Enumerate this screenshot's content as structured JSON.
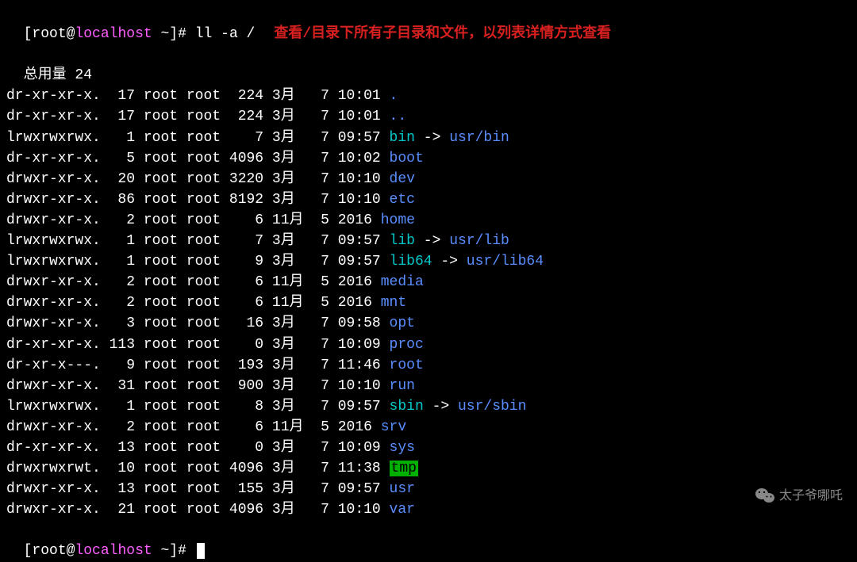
{
  "prompt": {
    "user": "root",
    "at": "@",
    "host": "localhost",
    "path": "~",
    "hash": "#",
    "command": "ll -a /"
  },
  "annotation": "查看/目录下所有子目录和文件，以列表详情方式查看",
  "total_label": "总用量",
  "total_value": "24",
  "files": [
    {
      "perms": "dr-xr-xr-x.",
      "links": "17",
      "owner": "root",
      "group": "root",
      "size": "224",
      "month": "3月 ",
      "day": "7",
      "time": "10:01",
      "name": ".",
      "kind": "dir"
    },
    {
      "perms": "dr-xr-xr-x.",
      "links": "17",
      "owner": "root",
      "group": "root",
      "size": "224",
      "month": "3月 ",
      "day": "7",
      "time": "10:01",
      "name": "..",
      "kind": "dir"
    },
    {
      "perms": "lrwxrwxrwx.",
      "links": "1",
      "owner": "root",
      "group": "root",
      "size": "7",
      "month": "3月 ",
      "day": "7",
      "time": "09:57",
      "name": "bin",
      "kind": "link",
      "target": "usr/bin"
    },
    {
      "perms": "dr-xr-xr-x.",
      "links": "5",
      "owner": "root",
      "group": "root",
      "size": "4096",
      "month": "3月 ",
      "day": "7",
      "time": "10:02",
      "name": "boot",
      "kind": "dir"
    },
    {
      "perms": "drwxr-xr-x.",
      "links": "20",
      "owner": "root",
      "group": "root",
      "size": "3220",
      "month": "3月 ",
      "day": "7",
      "time": "10:10",
      "name": "dev",
      "kind": "dir"
    },
    {
      "perms": "drwxr-xr-x.",
      "links": "86",
      "owner": "root",
      "group": "root",
      "size": "8192",
      "month": "3月 ",
      "day": "7",
      "time": "10:10",
      "name": "etc",
      "kind": "dir"
    },
    {
      "perms": "drwxr-xr-x.",
      "links": "2",
      "owner": "root",
      "group": "root",
      "size": "6",
      "month": "11月",
      "day": "5",
      "time": "2016 ",
      "name": "home",
      "kind": "dir"
    },
    {
      "perms": "lrwxrwxrwx.",
      "links": "1",
      "owner": "root",
      "group": "root",
      "size": "7",
      "month": "3月 ",
      "day": "7",
      "time": "09:57",
      "name": "lib",
      "kind": "link",
      "target": "usr/lib"
    },
    {
      "perms": "lrwxrwxrwx.",
      "links": "1",
      "owner": "root",
      "group": "root",
      "size": "9",
      "month": "3月 ",
      "day": "7",
      "time": "09:57",
      "name": "lib64",
      "kind": "link",
      "target": "usr/lib64"
    },
    {
      "perms": "drwxr-xr-x.",
      "links": "2",
      "owner": "root",
      "group": "root",
      "size": "6",
      "month": "11月",
      "day": "5",
      "time": "2016 ",
      "name": "media",
      "kind": "dir"
    },
    {
      "perms": "drwxr-xr-x.",
      "links": "2",
      "owner": "root",
      "group": "root",
      "size": "6",
      "month": "11月",
      "day": "5",
      "time": "2016 ",
      "name": "mnt",
      "kind": "dir"
    },
    {
      "perms": "drwxr-xr-x.",
      "links": "3",
      "owner": "root",
      "group": "root",
      "size": "16",
      "month": "3月 ",
      "day": "7",
      "time": "09:58",
      "name": "opt",
      "kind": "dir"
    },
    {
      "perms": "dr-xr-xr-x.",
      "links": "113",
      "owner": "root",
      "group": "root",
      "size": "0",
      "month": "3月 ",
      "day": "7",
      "time": "10:09",
      "name": "proc",
      "kind": "dir"
    },
    {
      "perms": "dr-xr-x---.",
      "links": "9",
      "owner": "root",
      "group": "root",
      "size": "193",
      "month": "3月 ",
      "day": "7",
      "time": "11:46",
      "name": "root",
      "kind": "dir"
    },
    {
      "perms": "drwxr-xr-x.",
      "links": "31",
      "owner": "root",
      "group": "root",
      "size": "900",
      "month": "3月 ",
      "day": "7",
      "time": "10:10",
      "name": "run",
      "kind": "dir"
    },
    {
      "perms": "lrwxrwxrwx.",
      "links": "1",
      "owner": "root",
      "group": "root",
      "size": "8",
      "month": "3月 ",
      "day": "7",
      "time": "09:57",
      "name": "sbin",
      "kind": "link",
      "target": "usr/sbin"
    },
    {
      "perms": "drwxr-xr-x.",
      "links": "2",
      "owner": "root",
      "group": "root",
      "size": "6",
      "month": "11月",
      "day": "5",
      "time": "2016 ",
      "name": "srv",
      "kind": "dir"
    },
    {
      "perms": "dr-xr-xr-x.",
      "links": "13",
      "owner": "root",
      "group": "root",
      "size": "0",
      "month": "3月 ",
      "day": "7",
      "time": "10:09",
      "name": "sys",
      "kind": "dir"
    },
    {
      "perms": "drwxrwxrwt.",
      "links": "10",
      "owner": "root",
      "group": "root",
      "size": "4096",
      "month": "3月 ",
      "day": "7",
      "time": "11:38",
      "name": "tmp",
      "kind": "tmp"
    },
    {
      "perms": "drwxr-xr-x.",
      "links": "13",
      "owner": "root",
      "group": "root",
      "size": "155",
      "month": "3月 ",
      "day": "7",
      "time": "09:57",
      "name": "usr",
      "kind": "dir"
    },
    {
      "perms": "drwxr-xr-x.",
      "links": "21",
      "owner": "root",
      "group": "root",
      "size": "4096",
      "month": "3月 ",
      "day": "7",
      "time": "10:10",
      "name": "var",
      "kind": "dir"
    }
  ],
  "watermark_text": "太子爷哪吒",
  "arrow_text": "->"
}
